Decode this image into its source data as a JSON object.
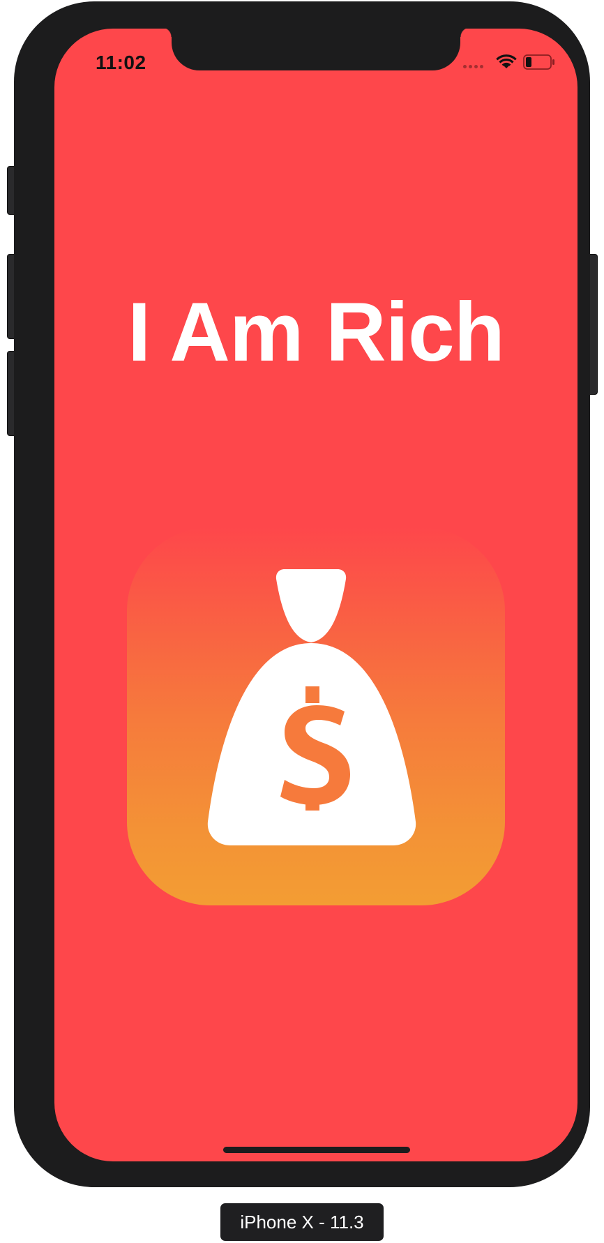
{
  "status_bar": {
    "time": "11:02",
    "wifi_icon": "wifi-icon",
    "battery_icon": "battery-low-icon",
    "signal_icon": "no-signal-dots-icon"
  },
  "app": {
    "title": "I Am Rich",
    "icon": "money-bag-dollar-icon",
    "background_color": "#FE474B",
    "icon_gradient_top": "#FE474B",
    "icon_gradient_bottom": "#F39D33"
  },
  "device": {
    "label": "iPhone X - 11.3"
  }
}
